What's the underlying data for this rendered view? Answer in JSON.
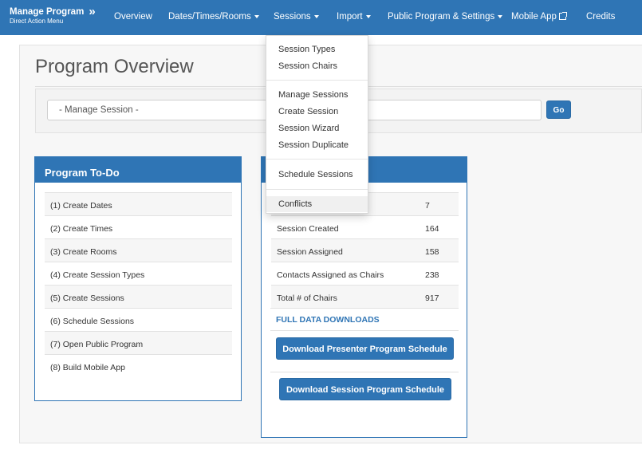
{
  "navbar": {
    "brand_title": "Manage Program",
    "brand_chevron": "»",
    "brand_subtitle": "Direct Action Menu",
    "items": [
      {
        "label": "Overview"
      },
      {
        "label": "Dates/Times/Rooms"
      },
      {
        "label": "Sessions"
      },
      {
        "label": "Import"
      },
      {
        "label": "Public Program & Settings"
      },
      {
        "label": "Mobile App"
      },
      {
        "label": "Credits"
      }
    ],
    "color": "#2f75b5"
  },
  "page": {
    "title": "Program Overview",
    "manage_select_value": "- Manage Session -",
    "go_label": "Go"
  },
  "todo": {
    "heading": "Program To-Do",
    "items": [
      "(1) Create Dates",
      "(2) Create Times",
      "(3) Create Rooms",
      "(4) Create Session Types",
      "(5) Create Sessions",
      "(6) Schedule Sessions",
      "(7) Open Public Program",
      "(8) Build Mobile App"
    ]
  },
  "stats": {
    "rows": [
      {
        "label": "",
        "value": "7"
      },
      {
        "label": "Session Created",
        "value": "164"
      },
      {
        "label": "Session Assigned",
        "value": "158"
      },
      {
        "label": "Contacts Assigned as Chairs",
        "value": "238"
      },
      {
        "label": "Total # of Chairs",
        "value": "917"
      }
    ],
    "downloads_label": "FULL DATA DOWNLOADS",
    "download_presenter": "Download Presenter Program Schedule",
    "download_session": "Download Session Program Schedule"
  },
  "sessions_menu": {
    "groups": [
      [
        "Session Types",
        "Session Chairs"
      ],
      [
        "Manage Sessions",
        "Create Session",
        "Session Wizard",
        "Session Duplicate"
      ],
      [
        "Schedule Sessions"
      ],
      [
        "Conflicts"
      ]
    ],
    "hovered": "Conflicts"
  },
  "icons": {
    "external_link": "external-link-icon",
    "caret": "caret-down-icon"
  }
}
